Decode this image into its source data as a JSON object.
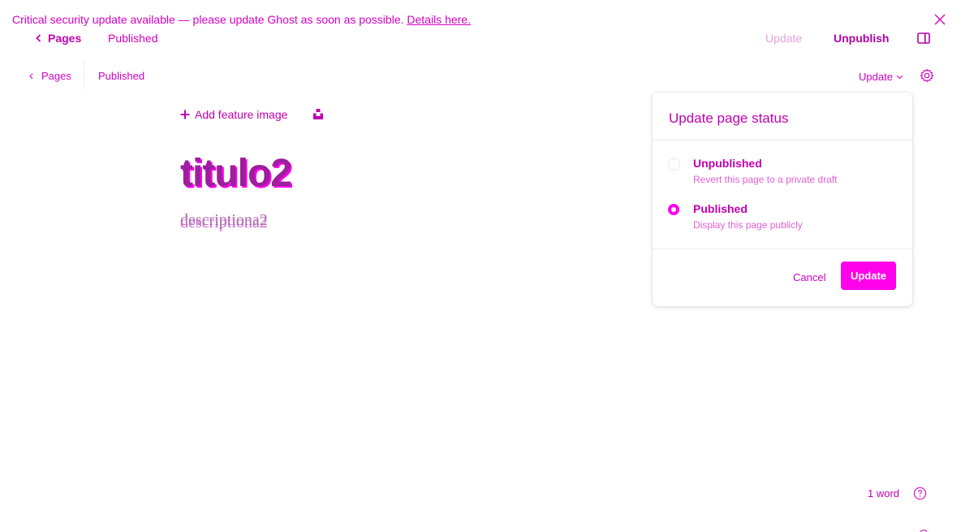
{
  "banner": {
    "message": "Critical security update available — please update Ghost as soon as possible.",
    "link": "Details here.",
    "close_icon": "close-icon"
  },
  "header": {
    "back_label": "Pages",
    "status": "Published",
    "update_label": "Update",
    "unpublish_label": "Unpublish",
    "sidebar_icon": "sidebar-toggle-icon"
  },
  "editor_nav": {
    "back_label": "Pages",
    "status": "Published",
    "update_dropdown_label": "Update",
    "settings_icon": "gear-icon"
  },
  "editor": {
    "add_feature_image_label": "Add feature image",
    "title": "titulo2",
    "excerpt": "descriptiona2"
  },
  "popover": {
    "title": "Update page status",
    "options": [
      {
        "label": "Unpublished",
        "description": "Revert this page to a private draft",
        "selected": false
      },
      {
        "label": "Published",
        "description": "Display this page publicly",
        "selected": true
      }
    ],
    "cancel_label": "Cancel",
    "update_label": "Update"
  },
  "footer": {
    "word_count": "1 word",
    "help_icon": "help-icon"
  },
  "colors": {
    "accent": "#ff00ea",
    "text_accent": "#c000b0",
    "light_accent": "#e6a0de"
  }
}
